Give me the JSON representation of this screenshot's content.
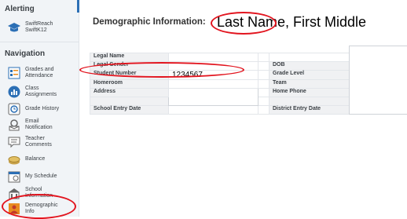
{
  "sidebar": {
    "alerting_heading": "Alerting",
    "alert_item": {
      "label": "SwiftReach\nSwiftK12",
      "icon": "graduation-cap-icon"
    },
    "navigation_heading": "Navigation",
    "items": [
      {
        "label": "Grades and\nAttendance",
        "icon": "grades-icon"
      },
      {
        "label": "Class\nAssignments",
        "icon": "assignments-icon"
      },
      {
        "label": "Grade History",
        "icon": "history-icon"
      },
      {
        "label": "Email\nNotification",
        "icon": "email-icon"
      },
      {
        "label": "Teacher\nComments",
        "icon": "comments-icon"
      },
      {
        "label": "Balance",
        "icon": "balance-icon"
      },
      {
        "label": "My Schedule",
        "icon": "schedule-icon"
      },
      {
        "label": "School\nInformation",
        "icon": "school-icon"
      },
      {
        "label": "Demographic\nInfo",
        "icon": "demographic-icon"
      }
    ]
  },
  "header": {
    "title": "Demographic Information:",
    "name_value": "Last Name, First Middle"
  },
  "fields": {
    "legal_name": "Legal Name",
    "legal_gender": "Legal Gender",
    "student_number": "Student Number",
    "student_number_value": "1234567",
    "homeroom": "Homeroom",
    "address": "Address",
    "school_entry_date": "School Entry Date",
    "dob": "DOB",
    "grade_level": "Grade Level",
    "team": "Team",
    "home_phone": "Home Phone",
    "district_entry_date": "District Entry Date"
  },
  "colors": {
    "accent": "#2c6fb5",
    "annotation": "#e2141e",
    "sidebar_bg": "#f1f4f7",
    "label_cell_bg": "#f0f1f3"
  }
}
